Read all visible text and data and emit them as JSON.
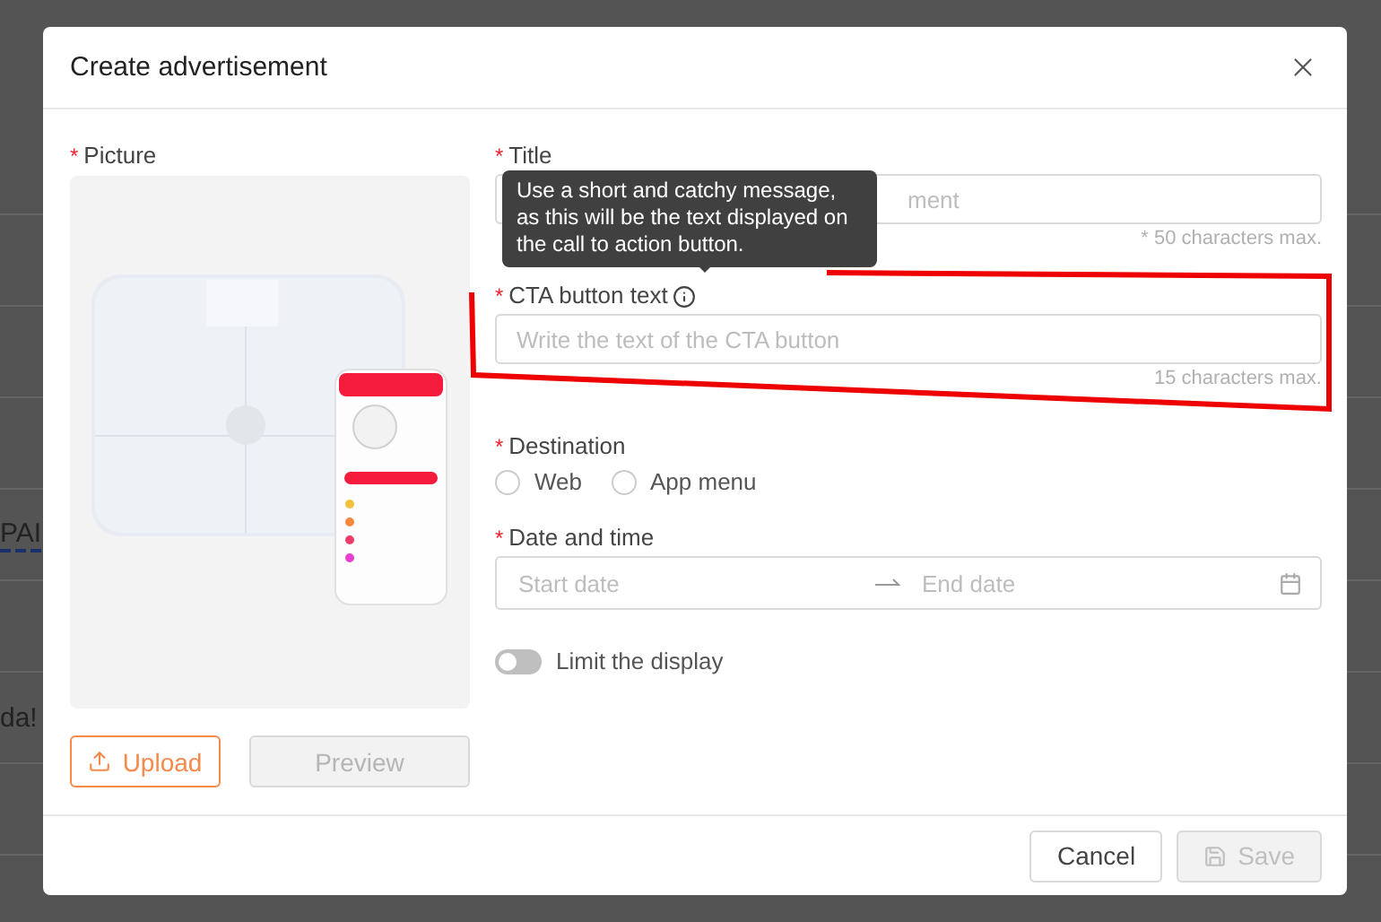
{
  "background": {
    "texts": [
      {
        "text": "PAI",
        "link": true
      },
      {
        "text": "da!",
        "link": false
      }
    ]
  },
  "dialog": {
    "title": "Create advertisement",
    "picture": {
      "label": "Picture",
      "required_mark": "*",
      "upload": "Upload",
      "preview": "Preview",
      "preview_disabled": true
    },
    "fields": [
      {
        "kind": "text",
        "label": "Title",
        "required_mark": "*",
        "placeholder": "ment",
        "hint": "* 50 characters max."
      },
      {
        "kind": "text",
        "label": "CTA button text",
        "required_mark": "*",
        "placeholder": "Write the text of the CTA button",
        "hint": "15 characters max.",
        "info": true,
        "highlighted": true
      },
      {
        "kind": "radio",
        "label": "Destination",
        "required_mark": "*",
        "options": [
          {
            "label": "Web",
            "selected": false
          },
          {
            "label": "App menu",
            "selected": false
          }
        ]
      },
      {
        "kind": "daterange",
        "label": "Date and time",
        "required_mark": "*",
        "start_placeholder": "Start date",
        "end_placeholder": "End date"
      },
      {
        "kind": "toggle",
        "label": "Limit the display",
        "on": false
      }
    ],
    "tooltip": {
      "text": "Use a short and catchy message, as this will be the text displayed on the call to action button."
    },
    "buttons": [
      {
        "label": "Cancel",
        "disabled": false
      },
      {
        "label": "Save",
        "disabled": true,
        "icon": true
      }
    ]
  }
}
